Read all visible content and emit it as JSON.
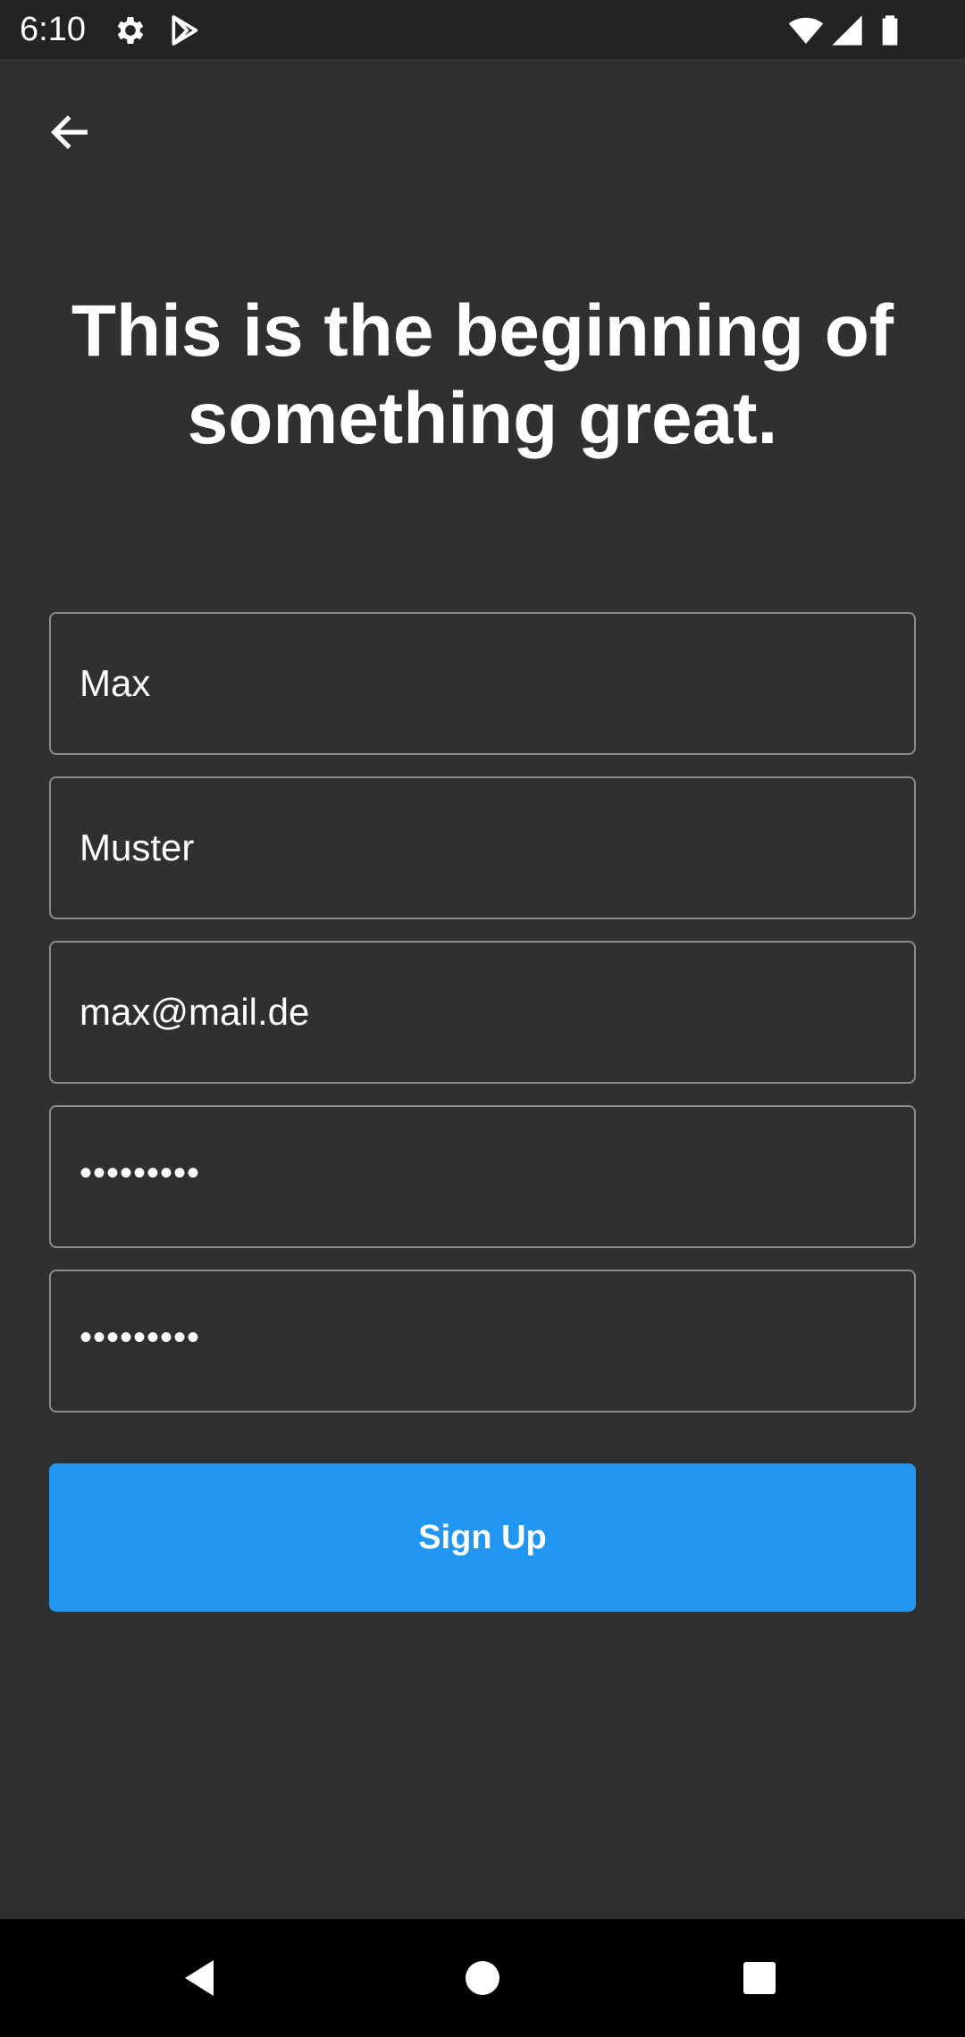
{
  "status_bar": {
    "time": "6:10",
    "icons": [
      "gear-icon",
      "play-store-icon",
      "wifi-icon",
      "signal-icon",
      "battery-icon"
    ]
  },
  "header": {
    "back_icon": "arrow-left-icon"
  },
  "headline": "This is the beginning of something great.",
  "form": {
    "first_name": "Max",
    "last_name": "Muster",
    "email": "max@mail.de",
    "password": "•••••••••",
    "password_confirm": "•••••••••"
  },
  "signup_button": {
    "label": "Sign Up",
    "color": "#2196f3"
  },
  "nav_bar": {
    "icons": [
      "back-triangle-icon",
      "home-circle-icon",
      "recents-square-icon"
    ]
  },
  "colors": {
    "background": "#303030",
    "status_bar": "#232323",
    "field_border": "#8a8a8a",
    "text": "#ffffff"
  }
}
